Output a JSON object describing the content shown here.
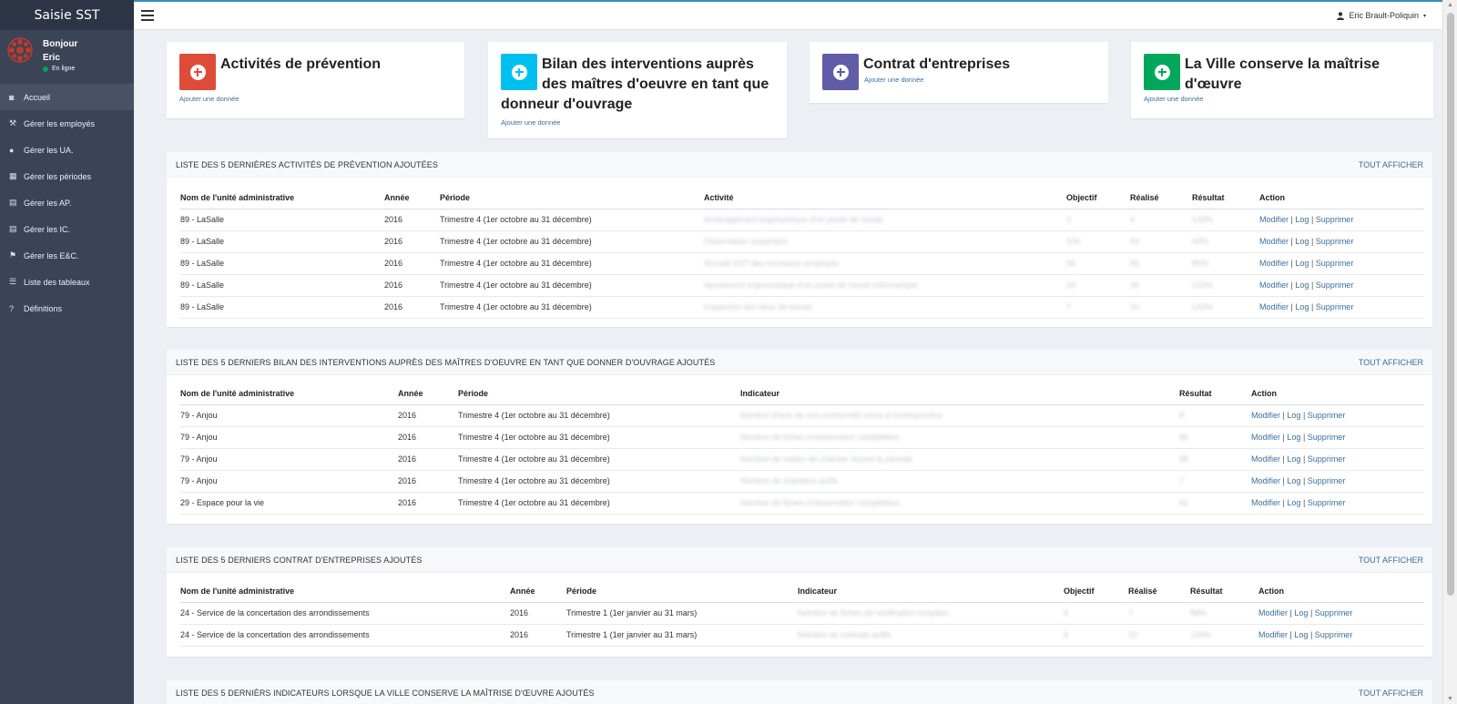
{
  "app": {
    "brand": "Saisie SST"
  },
  "user": {
    "greeting": "Bonjour",
    "name": "Eric",
    "status": "En ligne",
    "full_name": "Eric Brault-Poliquin"
  },
  "menu": [
    {
      "label": "Accueil",
      "icon": "dashboard-icon",
      "glyph": "◙"
    },
    {
      "label": "Gérer les employés",
      "icon": "wrench-icon",
      "glyph": "⚒"
    },
    {
      "label": "Gérer les UA.",
      "icon": "globe-icon",
      "glyph": "●"
    },
    {
      "label": "Gérer les périodes",
      "icon": "calendar-icon",
      "glyph": "▦"
    },
    {
      "label": "Gérer les AP.",
      "icon": "book-icon",
      "glyph": "▤"
    },
    {
      "label": "Gérer les IC.",
      "icon": "book-icon",
      "glyph": "▤"
    },
    {
      "label": "Gérer les E&C.",
      "icon": "flag-icon",
      "glyph": "⚑"
    },
    {
      "label": "Liste des tableaux",
      "icon": "list-icon",
      "glyph": "☰"
    },
    {
      "label": "Définitions",
      "icon": "question-icon",
      "glyph": "?"
    }
  ],
  "cards": [
    {
      "title_l1": "Activités de prévention",
      "title_l2": "",
      "title_l3": "",
      "link": "Ajouter une donnée",
      "color": "#dd4b39"
    },
    {
      "title_l1": "Bilan des interventions auprès",
      "title_l2": "des maîtres d'oeuvre en tant que",
      "title_l3": "donneur d'ouvrage",
      "link": "Ajouter une donnée",
      "color": "#00c0ef"
    },
    {
      "title_l1": "Contrat d'entreprises",
      "title_l2": "",
      "title_l3": "",
      "link": "Ajouter une donnée",
      "color": "#605ca8"
    },
    {
      "title_l1": "La Ville conserve la maîtrise",
      "title_l2": "d'œuvre",
      "title_l3": "",
      "link": "Ajouter une donnée",
      "color": "#00a65a"
    }
  ],
  "common": {
    "show_all": "TOUT AFFICHER",
    "modify": "Modifier",
    "log": "Log",
    "delete": "Supprimer",
    "sep": "|"
  },
  "panel1": {
    "title": "LISTE DES 5 DERNIÈRES ACTIVITÉS DE PRÉVENTION AJOUTÉES",
    "headers": [
      "Nom de l'unité administrative",
      "Année",
      "Période",
      "Activité",
      "Objectif",
      "Réalisé",
      "Résultat",
      "Action"
    ],
    "rows": [
      [
        "89 - LaSalle",
        "2016",
        "Trimestre 4 (1er octobre au 31 décembre)",
        "Aménagement ergonomique d'un poste de travail",
        "3",
        "4",
        "133%"
      ],
      [
        "89 - LaSalle",
        "2016",
        "Trimestre 4 (1er octobre au 31 décembre)",
        "Observation inspection",
        "106",
        "54",
        "64%"
      ],
      [
        "89 - LaSalle",
        "2016",
        "Trimestre 4 (1er octobre au 31 décembre)",
        "Accueil SST des nouveaux employés",
        "56",
        "56",
        "89%"
      ],
      [
        "89 - LaSalle",
        "2016",
        "Trimestre 4 (1er octobre au 31 décembre)",
        "Ajustement ergonomique d'un poste de travail informatique",
        "24",
        "40",
        "143%"
      ],
      [
        "89 - LaSalle",
        "2016",
        "Trimestre 4 (1er octobre au 31 décembre)",
        "Inspection des lieux de travail",
        "7",
        "10",
        "143%"
      ]
    ]
  },
  "panel2": {
    "title": "LISTE DES 5 DERNIERS BILAN DES INTERVENTIONS AUPRÈS DES MAÎTRES D'OEUVRE EN TANT QUE DONNER D'OUVRAGE AJOUTÉS",
    "headers": [
      "Nom de l'unité administrative",
      "Année",
      "Période",
      "Indicateur",
      "Résultat",
      "Action"
    ],
    "rows": [
      [
        "79 - Anjou",
        "2016",
        "Trimestre 4 (1er octobre au 31 décembre)",
        "Nombre d'avis de non-conformité remis à l'entrepreneur",
        "8"
      ],
      [
        "79 - Anjou",
        "2016",
        "Trimestre 4 (1er octobre au 31 décembre)",
        "Nombre de fiches d'observation complétées",
        "86"
      ],
      [
        "79 - Anjou",
        "2016",
        "Trimestre 4 (1er octobre au 31 décembre)",
        "Nombre de visites de chantier durant la période",
        "88"
      ],
      [
        "79 - Anjou",
        "2016",
        "Trimestre 4 (1er octobre au 31 décembre)",
        "Nombre de chantiers actifs",
        "7"
      ],
      [
        "29 - Espace pour la vie",
        "2016",
        "Trimestre 4 (1er octobre au 31 décembre)",
        "Nombre de fiches d'observation complétées",
        "62"
      ]
    ]
  },
  "panel3": {
    "title": "LISTE DES 5 DERNIERS CONTRAT D'ENTREPRISES AJOUTÉS",
    "headers": [
      "Nom de l'unité administrative",
      "Année",
      "Période",
      "Indicateur",
      "Objectif",
      "Réalisé",
      "Résultat",
      "Action"
    ],
    "rows": [
      [
        "24 - Service de la concertation des arrondissements",
        "2016",
        "Trimestre 1 (1er janvier au 31 mars)",
        "Nombre de fiches de vérification remplies",
        "8",
        "7",
        "88%"
      ],
      [
        "24 - Service de la concertation des arrondissements",
        "2016",
        "Trimestre 1 (1er janvier au 31 mars)",
        "Nombre de contrats actifs",
        "8",
        "10",
        "125%"
      ]
    ]
  },
  "panel4": {
    "title": "LISTE DES 5 DERNIÈRS INDICATEURS LORSQUE LA VILLE CONSERVE LA MAÎTRISE D'ŒUVRE AJOUTÉS"
  }
}
